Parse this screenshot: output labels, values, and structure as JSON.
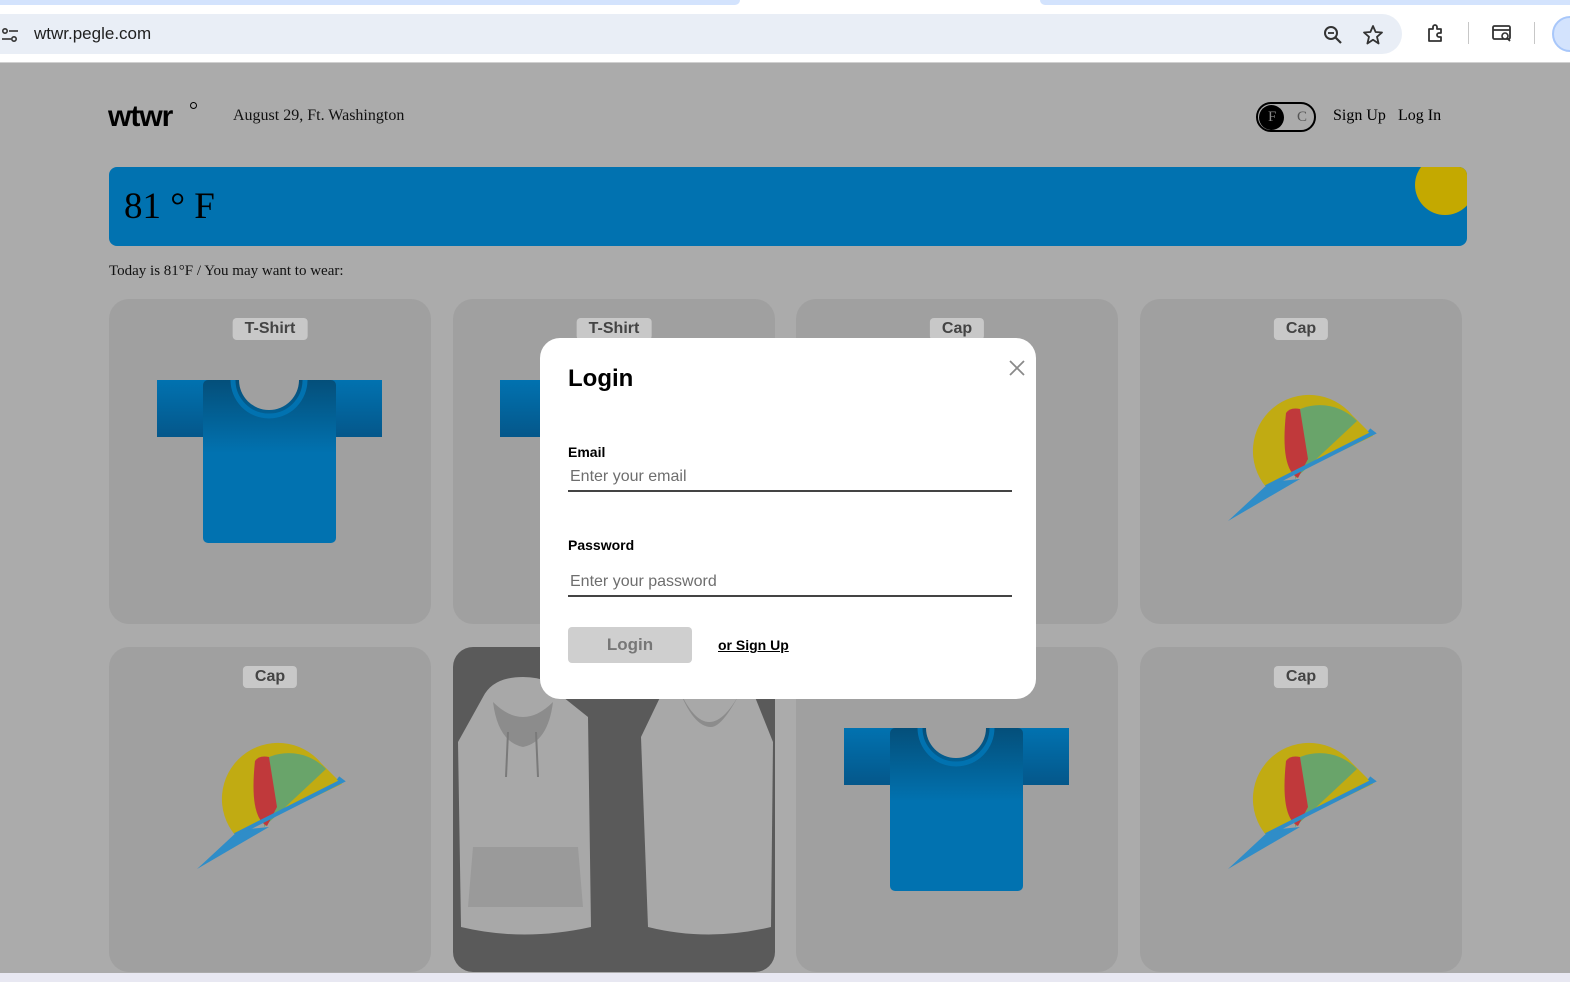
{
  "browser": {
    "url": "wtwr.pegle.com",
    "icons": [
      "site-info-icon",
      "zoom-icon",
      "bookmark-star-icon",
      "extensions-icon",
      "tab-search-icon",
      "profile-icon"
    ]
  },
  "header": {
    "logo": "wtwr",
    "date_location": "August 29, Ft. Washington",
    "toggle": {
      "f_label": "F",
      "c_label": "C",
      "selected": "F"
    },
    "signup": "Sign Up",
    "login": "Log In"
  },
  "weather": {
    "temperature": "81 ° F",
    "colors": {
      "banner": "#0172b0",
      "sun": "#c4a900"
    }
  },
  "suggestion": "Today is 81°F / You may want to wear:",
  "cards": [
    {
      "name": "T-Shirt",
      "image": "tshirt"
    },
    {
      "name": "T-Shirt",
      "image": "tshirt"
    },
    {
      "name": "Cap",
      "image": "cap"
    },
    {
      "name": "Cap",
      "image": "cap"
    },
    {
      "name": "Cap",
      "image": "cap"
    },
    {
      "name": "",
      "image": "hoodie-photo"
    },
    {
      "name": "",
      "image": "tshirt"
    },
    {
      "name": "Cap",
      "image": "cap"
    }
  ],
  "modal": {
    "title": "Login",
    "email_label": "Email",
    "email_placeholder": "Enter your email",
    "email_value": "",
    "password_label": "Password",
    "password_placeholder": "Enter your password",
    "password_value": "",
    "submit": "Login",
    "alt_link": "or Sign Up"
  }
}
